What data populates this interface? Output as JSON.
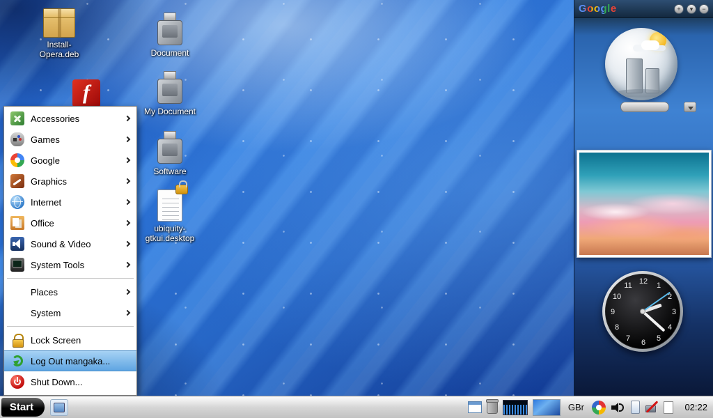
{
  "desktop": {
    "icons": [
      {
        "label": "Install-Opera.deb"
      },
      {
        "label": ""
      },
      {
        "label": "Document"
      },
      {
        "label": "My Document"
      },
      {
        "label": "Software"
      },
      {
        "label": "ubiquity-gtkui.desktop"
      }
    ]
  },
  "start_menu": {
    "items": [
      {
        "label": "Accessories"
      },
      {
        "label": "Games"
      },
      {
        "label": "Google"
      },
      {
        "label": "Graphics"
      },
      {
        "label": "Internet"
      },
      {
        "label": "Office"
      },
      {
        "label": "Sound & Video"
      },
      {
        "label": "System Tools"
      },
      {
        "label": "Places"
      },
      {
        "label": "System"
      },
      {
        "label": "Lock Screen"
      },
      {
        "label": "Log Out mangaka..."
      },
      {
        "label": "Shut Down..."
      }
    ]
  },
  "sidebar": {
    "logo": "Google",
    "header_buttons": {
      "add": "+",
      "menu": "▾",
      "minimize": "−"
    },
    "clock": {
      "numbers": [
        "12",
        "1",
        "2",
        "3",
        "4",
        "5",
        "6",
        "7",
        "8",
        "9",
        "10",
        "11"
      ]
    }
  },
  "taskbar": {
    "start_label": "Start",
    "keyboard_layout": "GBr",
    "clock": "02:22"
  }
}
